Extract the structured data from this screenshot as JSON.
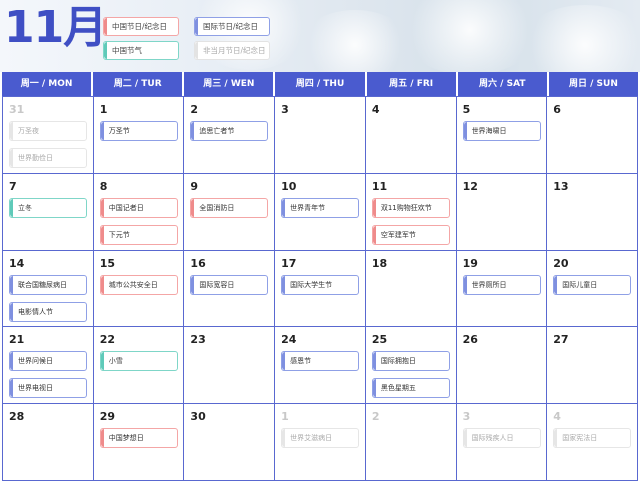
{
  "header": {
    "month_label": "11月",
    "legend": [
      {
        "label": "中国节日/纪念日",
        "color": "red"
      },
      {
        "label": "国际节日/纪念日",
        "color": "blue"
      },
      {
        "label": "中国节气",
        "color": "teal"
      },
      {
        "label": "非当月节日/纪念日",
        "color": "gray"
      }
    ]
  },
  "weekdays": [
    "周一 / MON",
    "周二 / TUR",
    "周三 / WEN",
    "周四 / THU",
    "周五 / FRI",
    "周六 / SAT",
    "周日 / SUN"
  ],
  "weeks": [
    [
      {
        "day": "31",
        "other": true,
        "events": [
          {
            "label": "万圣夜",
            "color": "gray"
          },
          {
            "label": "世界勤俭日",
            "color": "gray"
          }
        ]
      },
      {
        "day": "1",
        "events": [
          {
            "label": "万圣节",
            "color": "blue"
          }
        ]
      },
      {
        "day": "2",
        "events": [
          {
            "label": "追思亡者节",
            "color": "blue"
          }
        ]
      },
      {
        "day": "3",
        "events": []
      },
      {
        "day": "4",
        "events": []
      },
      {
        "day": "5",
        "events": [
          {
            "label": "世界海啸日",
            "color": "blue"
          }
        ]
      },
      {
        "day": "6",
        "events": []
      }
    ],
    [
      {
        "day": "7",
        "events": [
          {
            "label": "立冬",
            "color": "teal"
          }
        ]
      },
      {
        "day": "8",
        "events": [
          {
            "label": "中国记者日",
            "color": "red"
          },
          {
            "label": "下元节",
            "color": "red"
          }
        ]
      },
      {
        "day": "9",
        "events": [
          {
            "label": "全国消防日",
            "color": "red"
          }
        ]
      },
      {
        "day": "10",
        "events": [
          {
            "label": "世界青年节",
            "color": "blue"
          }
        ]
      },
      {
        "day": "11",
        "events": [
          {
            "label": "双11购物狂欢节",
            "color": "red"
          },
          {
            "label": "空军建军节",
            "color": "red"
          }
        ]
      },
      {
        "day": "12",
        "events": []
      },
      {
        "day": "13",
        "events": []
      }
    ],
    [
      {
        "day": "14",
        "events": [
          {
            "label": "联合国糖尿病日",
            "color": "blue"
          },
          {
            "label": "电影情人节",
            "color": "blue"
          }
        ]
      },
      {
        "day": "15",
        "events": [
          {
            "label": "城市公共安全日",
            "color": "red"
          }
        ]
      },
      {
        "day": "16",
        "events": [
          {
            "label": "国际宽容日",
            "color": "blue"
          }
        ]
      },
      {
        "day": "17",
        "events": [
          {
            "label": "国际大学生节",
            "color": "blue"
          }
        ]
      },
      {
        "day": "18",
        "events": []
      },
      {
        "day": "19",
        "events": [
          {
            "label": "世界厕所日",
            "color": "blue"
          }
        ]
      },
      {
        "day": "20",
        "events": [
          {
            "label": "国际儿童日",
            "color": "blue"
          }
        ]
      }
    ],
    [
      {
        "day": "21",
        "events": [
          {
            "label": "世界问候日",
            "color": "blue"
          },
          {
            "label": "世界电视日",
            "color": "blue"
          }
        ]
      },
      {
        "day": "22",
        "events": [
          {
            "label": "小雪",
            "color": "teal"
          }
        ]
      },
      {
        "day": "23",
        "events": []
      },
      {
        "day": "24",
        "events": [
          {
            "label": "感恩节",
            "color": "blue"
          }
        ]
      },
      {
        "day": "25",
        "events": [
          {
            "label": "国际拥抱日",
            "color": "blue"
          },
          {
            "label": "黑色星期五",
            "color": "blue"
          }
        ]
      },
      {
        "day": "26",
        "events": []
      },
      {
        "day": "27",
        "events": []
      }
    ],
    [
      {
        "day": "28",
        "events": []
      },
      {
        "day": "29",
        "events": [
          {
            "label": "中国梦想日",
            "color": "red"
          }
        ]
      },
      {
        "day": "30",
        "events": []
      },
      {
        "day": "1",
        "other": true,
        "events": [
          {
            "label": "世界艾滋病日",
            "color": "gray"
          }
        ]
      },
      {
        "day": "2",
        "other": true,
        "events": []
      },
      {
        "day": "3",
        "other": true,
        "events": [
          {
            "label": "国际残疾人日",
            "color": "gray"
          }
        ]
      },
      {
        "day": "4",
        "other": true,
        "events": [
          {
            "label": "国家宪法日",
            "color": "gray"
          }
        ]
      }
    ]
  ]
}
